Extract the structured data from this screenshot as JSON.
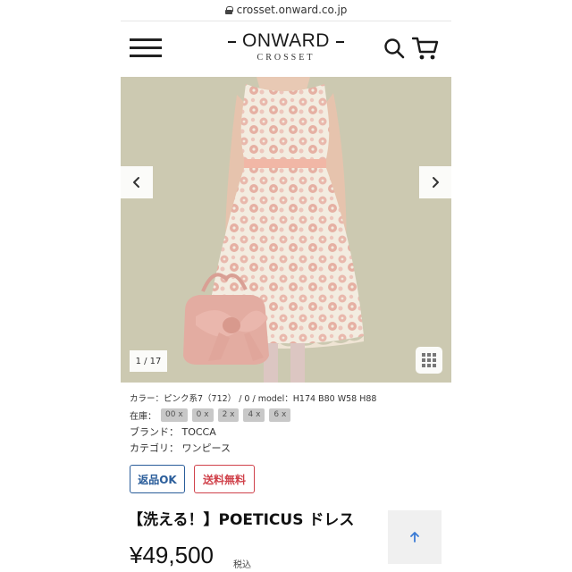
{
  "browser": {
    "url": "crosset.onward.co.jp"
  },
  "header": {
    "logo_main": "ONWARD",
    "logo_sub": "CROSSET"
  },
  "gallery": {
    "counter": "1 / 17"
  },
  "product": {
    "color_line": "カラー：ピンク系7（712） / 0 / model：H174 B80 W58 H88",
    "stock_label": "在庫：",
    "stock_sizes": [
      "00 x",
      "0 x",
      "2 x",
      "4 x",
      "6 x"
    ],
    "brand_line": "ブランド： TOCCA",
    "category_line": "カテゴリ： ワンピース",
    "badges": {
      "return": "返品OK",
      "shipping": "送料無料"
    },
    "title": "【洗える！】POETICUS ドレス",
    "price": "¥49,500",
    "tax": "税込"
  },
  "colors": {
    "return_badge": "#2a5d9a",
    "shipping_badge": "#d0424b",
    "photo_background": "#c9c6ae",
    "dress_pink": "#e9b8ac",
    "dress_cream": "#f3ece0"
  },
  "icons": [
    "lock-icon",
    "hamburger-menu-icon",
    "search-icon",
    "cart-icon",
    "chevron-left-icon",
    "chevron-right-icon",
    "grid-icon",
    "arrow-up-icon"
  ]
}
